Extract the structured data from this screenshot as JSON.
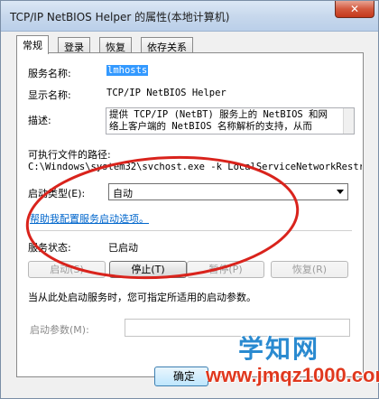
{
  "window": {
    "title": "TCP/IP NetBIOS Helper 的属性(本地计算机)",
    "close_label": "✕"
  },
  "tabs": [
    {
      "label": "常规"
    },
    {
      "label": "登录"
    },
    {
      "label": "恢复"
    },
    {
      "label": "依存关系"
    }
  ],
  "general": {
    "service_name_label": "服务名称:",
    "service_name_value": "lmhosts",
    "display_name_label": "显示名称:",
    "display_name_value": "TCP/IP NetBIOS Helper",
    "description_label": "描述:",
    "description_line1": "提供 TCP/IP (NetBT) 服务上的 NetBIOS 和网",
    "description_line2": "络上客户端的 NetBIOS 名称解析的支持，从而",
    "exe_path_label": "可执行文件的路径:",
    "exe_path_value": "C:\\Windows\\system32\\svchost.exe -k LocalServiceNetworkRestri",
    "startup_type_label": "启动类型(E):",
    "startup_type_value": "自动",
    "help_link": "帮助我配置服务启动选项。",
    "service_status_label": "服务状态:",
    "service_status_value": "已启动",
    "start_button": "启动(S)",
    "stop_button": "停止(T)",
    "pause_button": "暂停(P)",
    "resume_button": "恢复(R)",
    "hint_text": "当从此处启动服务时，您可指定所适用的启动参数。",
    "start_params_label": "启动参数(M):",
    "start_params_value": ""
  },
  "footer": {
    "ok_button": "确定"
  },
  "watermark": {
    "brand_cn": "学知网",
    "brand_url": "www.jmqz1000.com"
  },
  "colors": {
    "annotation_ellipse": "#d9231c",
    "link": "#0066cc",
    "selection": "#3399ff"
  }
}
